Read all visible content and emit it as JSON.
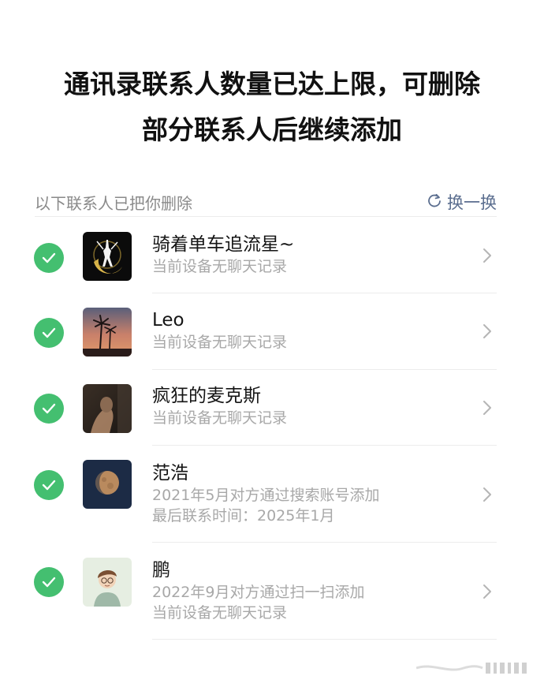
{
  "title": {
    "line1": "通讯录联系人数量已达上限，可删除",
    "line2": "部分联系人后继续添加"
  },
  "section": {
    "label": "以下联系人已把你删除",
    "refresh_label": "换一换"
  },
  "contacts": [
    {
      "name": "骑着单车追流星~",
      "details": [
        "当前设备无聊天记录"
      ],
      "checked": true,
      "avatar": "sailor-moon-silhouette-avatar"
    },
    {
      "name": "Leo",
      "details": [
        "当前设备无聊天记录"
      ],
      "checked": true,
      "avatar": "palm-trees-sunset-avatar"
    },
    {
      "name": "疯狂的麦克斯",
      "details": [
        "当前设备无聊天记录"
      ],
      "checked": true,
      "avatar": "dark-portrait-avatar"
    },
    {
      "name": "范浩",
      "details": [
        "2021年5月对方通过搜索账号添加",
        "最后联系时间：2025年1月"
      ],
      "checked": true,
      "avatar": "moon-avatar"
    },
    {
      "name": "鹏",
      "details": [
        "2022年9月对方通过扫一扫添加",
        "当前设备无聊天记录"
      ],
      "checked": true,
      "avatar": "cartoon-boy-avatar"
    }
  ],
  "colors": {
    "check_green": "#44bf70",
    "link_blue_gray": "#5b6e8f",
    "secondary_text": "#a8a8a8"
  }
}
